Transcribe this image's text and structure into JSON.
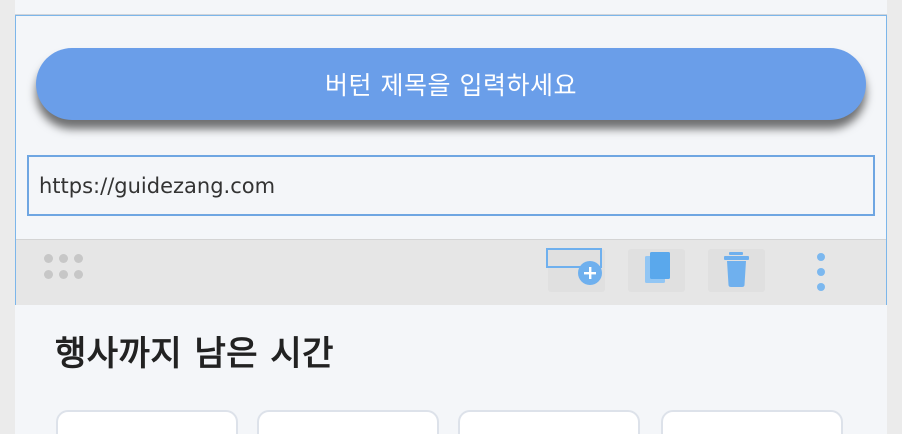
{
  "button_block": {
    "title_placeholder": "버턴 제목을 입력하세요",
    "url_value": "https://guidezang.com"
  },
  "toolbar": {
    "icons": [
      "drag-handle-icon",
      "add-button-icon",
      "copy-icon",
      "trash-icon",
      "more-vertical-icon"
    ],
    "accent_color": "#7cb8ef"
  },
  "countdown": {
    "title": "행사까지 남은 시간"
  },
  "colors": {
    "button_bg": "#6a9ee9",
    "selection_border": "#7cb6ea"
  }
}
